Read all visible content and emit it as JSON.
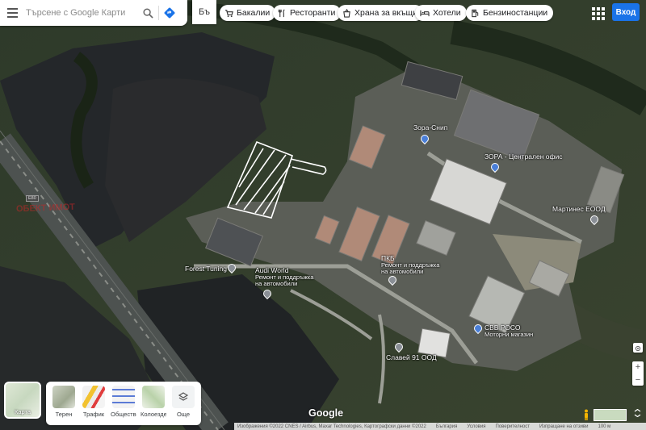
{
  "search": {
    "placeholder": "Търсене с Google Карти"
  },
  "chips": [
    {
      "label": "Бакалии",
      "icon": "cart-icon"
    },
    {
      "label": "Ресторанти",
      "icon": "fork-knife-icon"
    },
    {
      "label": "Храна за вкъщи",
      "icon": "takeout-icon"
    },
    {
      "label": "Хотели",
      "icon": "bed-icon"
    },
    {
      "label": "Бензиностанции",
      "icon": "gas-station-icon"
    }
  ],
  "signin_label": "Вход",
  "mode_glyph": "Бъ",
  "map_labels": {
    "zora_snip": "Зора-Снип",
    "zora_office": "ЗОРА - Централен офис",
    "martines": "Мартинес ЕООД",
    "forest_tuning": "Forest Tuning",
    "audi_world_1": "Audi World",
    "audi_world_2": "Ремонт и поддръжка",
    "audi_world_3": "на автомобили",
    "pkb_1": "ПКБ",
    "pkb_2": "Ремонт и поддръжка",
    "pkb_3": "на автомобили",
    "cvv_1": "СВВ РОСО",
    "cvv_2": "Моторни магазин",
    "slavei": "Славей 91 ООД",
    "road_shield": "E80",
    "watermark": "ОБЕКТ ИМОТ"
  },
  "layers": {
    "current": "Карта",
    "items": [
      "Терен",
      "Трафик",
      "Обществен транспорт",
      "Колоездене",
      "Още"
    ]
  },
  "google_logo": "Google",
  "footer": {
    "imagery": "Изображения ©2022 CNES / Airbus, Maxar Technologies, Картографски данни ©2022",
    "country": "България",
    "terms": "Условия",
    "privacy": "Поверителност",
    "feedback": "Изпращане на отзиви",
    "scale": "100 м"
  },
  "colors": {
    "accent": "#1a73e8",
    "pin_grey": "#8a8f96",
    "pin_blue": "#4a7fd8"
  }
}
